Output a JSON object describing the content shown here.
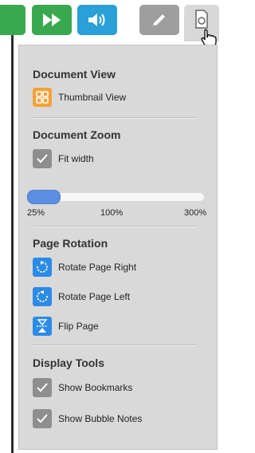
{
  "toolbar": {
    "buttons": [
      {
        "icon": "fast-forward-icon",
        "color": "#3aa84e"
      },
      {
        "icon": "sound-icon",
        "color": "#2a9fd8"
      },
      {
        "icon": "pen-icon",
        "color": "#9e9e9e"
      },
      {
        "icon": "document-settings-icon",
        "color": "#d8d8d8"
      }
    ]
  },
  "panel": {
    "document_view": {
      "title": "Document View",
      "thumbnail_label": "Thumbnail View"
    },
    "document_zoom": {
      "title": "Document Zoom",
      "fit_width_label": "Fit width",
      "fit_width_checked": true,
      "slider": {
        "min_label": "25%",
        "mid_label": "100%",
        "max_label": "300%",
        "value_percent": 25
      }
    },
    "page_rotation": {
      "title": "Page Rotation",
      "rotate_right_label": "Rotate Page Right",
      "rotate_left_label": "Rotate Page Left",
      "flip_label": "Flip Page"
    },
    "display_tools": {
      "title": "Display Tools",
      "bookmarks_label": "Show Bookmarks",
      "bookmarks_checked": true,
      "bubble_notes_label": "Show Bubble Notes",
      "bubble_notes_checked": true
    }
  },
  "colors": {
    "accent_blue": "#2b8be6",
    "thumbnail_orange": "#f7a23a",
    "checkbox_gray": "#8e8e8e",
    "panel_bg": "#d9d9d9"
  }
}
